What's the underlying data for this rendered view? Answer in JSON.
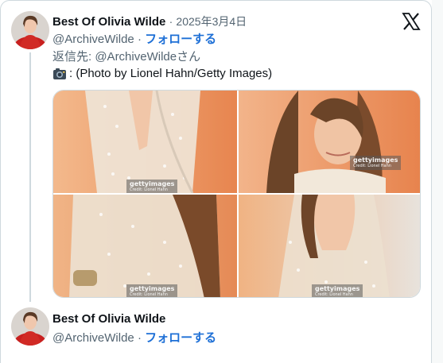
{
  "tweet": {
    "display_name": "Best Of Olivia Wilde",
    "separator": "·",
    "date": "2025年3月4日",
    "handle": "@ArchiveWilde",
    "follow_label": "フォローする",
    "reply_to": "返信先: @ArchiveWildeさん",
    "text": ": (Photo by Lionel Hahn/Getty Images)",
    "emoji_icon": "camera-emoji",
    "photos": [
      {
        "watermark": "gettyimages",
        "credit": "Credit: Lionel Hahn"
      },
      {
        "watermark": "gettyimages",
        "credit": "Credit: Lionel Hahn"
      },
      {
        "watermark": "gettyimages",
        "credit": "Credit: Lionel Hahn"
      },
      {
        "watermark": "gettyimages",
        "credit": "Credit: Lionel Hahn"
      }
    ]
  },
  "next_tweet": {
    "display_name": "Best Of Olivia Wilde",
    "handle": "@ArchiveWilde",
    "follow_label": "フォローする"
  },
  "colors": {
    "accent": "#1d6fd6",
    "secondary_text": "#536471",
    "border": "#cfd9de",
    "photo_background": "#e8875a"
  }
}
